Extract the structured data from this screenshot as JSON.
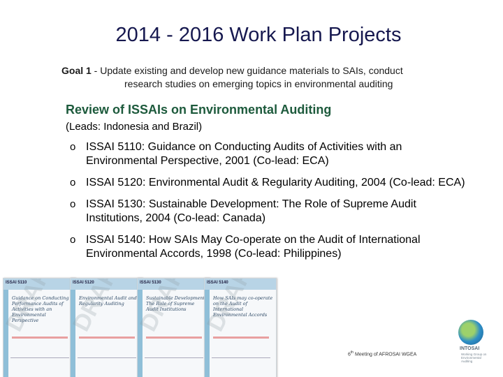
{
  "title": "2014 - 2016 Work Plan Projects",
  "goal": {
    "label": "Goal 1",
    "line1": " - Update existing and develop new guidance materials to SAIs, conduct",
    "line2": "research studies on emerging topics in environmental auditing"
  },
  "section": {
    "heading": "Review of ISSAIs on Environmental Auditing",
    "leads": "(Leads: Indonesia and Brazil)"
  },
  "bullets": [
    {
      "marker": "o",
      "text": "ISSAI 5110: Guidance on Conducting Audits of Activities with an Environmental Perspective, 2001 (Co-lead: ECA)"
    },
    {
      "marker": "o",
      "text": "ISSAI 5120: Environmental Audit & Regularity Auditing, 2004 (Co-lead: ECA)"
    },
    {
      "marker": "o",
      "text": "ISSAI 5130: Sustainable Development: The Role of Supreme Audit Institutions, 2004 (Co-lead: Canada)"
    },
    {
      "marker": "o",
      "text": "ISSAI 5140: How SAIs May Co-operate on the Audit of International Environmental Accords, 1998 (Co-lead: Philippines)"
    }
  ],
  "covers": [
    {
      "code": "ISSAI 5110",
      "title": "Guidance on Conducting Performance Audits of Activities with an Environmental Perspective",
      "watermark": "DRAFT"
    },
    {
      "code": "ISSAI 5120",
      "title": "Environmental Audit and Regularity Auditing",
      "watermark": "DRAFT"
    },
    {
      "code": "ISSAI 5130",
      "title": "Sustainable Development: The Role of Supreme Audit Institutions",
      "watermark": "DRAFT"
    },
    {
      "code": "ISSAI 5140",
      "title": "How SAIs may co-operate on the Audit of International Environmental Accords",
      "watermark": "DRAFT"
    }
  ],
  "footer": {
    "meeting_num": "6",
    "meeting_sup": "th",
    "meeting_text": " Meeting of AFROSAI WGEA"
  },
  "logo": {
    "name": "INTOSAI",
    "tagline": "Working Group on Environmental Auditing"
  },
  "colors": {
    "title": "#16184f",
    "heading": "#1d5a3c",
    "cover_bar": "#b8d4e6"
  }
}
